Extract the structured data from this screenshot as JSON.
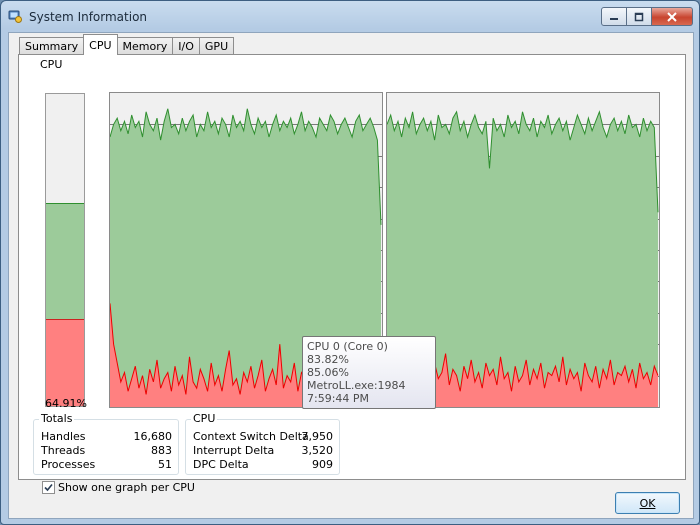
{
  "window": {
    "title": "System Information",
    "icon": "system-info-icon",
    "controls": [
      "minimize-icon",
      "maximize-icon",
      "close-icon"
    ]
  },
  "tabs": [
    {
      "label": "Summary",
      "active": false
    },
    {
      "label": "CPU",
      "active": true
    },
    {
      "label": "Memory",
      "active": false
    },
    {
      "label": "I/O",
      "active": false
    },
    {
      "label": "GPU",
      "active": false
    }
  ],
  "cpu_meter": {
    "label": "CPU",
    "percent_text": "64.91%",
    "total": 0.6491,
    "kernel": 0.2765
  },
  "colors": {
    "cpu_total_fill": "#9ccb9a",
    "cpu_total_line": "#2f8f2f",
    "cpu_kernel_fill": "#ff8080",
    "cpu_kernel_line": "#ee0000",
    "graph_background": "#f0f0f0",
    "gridline": "#7a7a7a"
  },
  "chart_data": [
    {
      "type": "area",
      "series": [
        {
          "values": [
            0.86,
            0.9,
            0.92,
            0.88,
            0.91,
            0.87,
            0.93,
            0.89,
            0.91,
            0.86,
            0.94,
            0.9,
            0.88,
            0.92,
            0.85,
            0.91,
            0.95,
            0.89,
            0.9,
            0.87,
            0.92,
            0.88,
            0.91,
            0.93,
            0.86,
            0.9,
            0.88,
            0.94,
            0.89,
            0.91,
            0.87,
            0.92,
            0.9,
            0.86,
            0.93,
            0.89,
            0.91,
            0.88,
            0.95,
            0.9,
            0.87,
            0.92,
            0.89,
            0.91,
            0.86,
            0.9,
            0.93,
            0.88,
            0.91,
            0.89,
            0.92,
            0.87,
            0.9,
            0.94,
            0.88,
            0.91,
            0.89,
            0.86,
            0.92,
            0.9,
            0.88,
            0.93,
            0.91,
            0.87,
            0.9,
            0.92,
            0.89,
            0.86,
            0.91,
            0.93,
            0.88,
            0.9,
            0.92,
            0.89,
            0.85,
            0.58
          ]
        },
        {
          "values": [
            0.33,
            0.2,
            0.14,
            0.08,
            0.11,
            0.05,
            0.09,
            0.13,
            0.06,
            0.1,
            0.04,
            0.12,
            0.08,
            0.15,
            0.06,
            0.09,
            0.11,
            0.05,
            0.13,
            0.07,
            0.1,
            0.04,
            0.16,
            0.08,
            0.06,
            0.12,
            0.09,
            0.05,
            0.14,
            0.07,
            0.1,
            0.05,
            0.12,
            0.18,
            0.07,
            0.09,
            0.04,
            0.11,
            0.08,
            0.13,
            0.06,
            0.1,
            0.15,
            0.05,
            0.09,
            0.12,
            0.07,
            0.2,
            0.06,
            0.1,
            0.08,
            0.14,
            0.05,
            0.11,
            0.09,
            0.06,
            0.13,
            0.08,
            0.17,
            0.07,
            0.1,
            0.05,
            0.12,
            0.09,
            0.06,
            0.15,
            0.08,
            0.11,
            0.05,
            0.13,
            0.07,
            0.1,
            0.16,
            0.08,
            0.09,
            0.06
          ]
        }
      ],
      "ylim": [
        0,
        1
      ],
      "grid": true
    },
    {
      "type": "area",
      "series": [
        {
          "values": [
            0.9,
            0.93,
            0.88,
            0.91,
            0.86,
            0.92,
            0.89,
            0.94,
            0.87,
            0.9,
            0.92,
            0.88,
            0.91,
            0.85,
            0.93,
            0.89,
            0.9,
            0.87,
            0.92,
            0.94,
            0.88,
            0.91,
            0.86,
            0.9,
            0.93,
            0.89,
            0.87,
            0.91,
            0.76,
            0.92,
            0.88,
            0.9,
            0.86,
            0.93,
            0.89,
            0.91,
            0.87,
            0.94,
            0.9,
            0.88,
            0.92,
            0.86,
            0.91,
            0.89,
            0.93,
            0.87,
            0.9,
            0.92,
            0.88,
            0.91,
            0.85,
            0.89,
            0.93,
            0.9,
            0.87,
            0.92,
            0.88,
            0.91,
            0.94,
            0.89,
            0.86,
            0.9,
            0.92,
            0.88,
            0.91,
            0.87,
            0.93,
            0.89,
            0.9,
            0.86,
            0.92,
            0.88,
            0.91,
            0.89,
            0.62
          ]
        },
        {
          "values": [
            0.18,
            0.12,
            0.16,
            0.09,
            0.14,
            0.11,
            0.07,
            0.13,
            0.1,
            0.15,
            0.08,
            0.12,
            0.06,
            0.14,
            0.09,
            0.11,
            0.17,
            0.07,
            0.12,
            0.1,
            0.05,
            0.13,
            0.09,
            0.15,
            0.08,
            0.11,
            0.06,
            0.14,
            0.1,
            0.12,
            0.07,
            0.16,
            0.09,
            0.11,
            0.05,
            0.13,
            0.08,
            0.1,
            0.15,
            0.07,
            0.12,
            0.09,
            0.14,
            0.06,
            0.11,
            0.1,
            0.13,
            0.08,
            0.16,
            0.07,
            0.12,
            0.09,
            0.11,
            0.05,
            0.14,
            0.1,
            0.08,
            0.13,
            0.06,
            0.12,
            0.09,
            0.15,
            0.07,
            0.11,
            0.1,
            0.13,
            0.08,
            0.12,
            0.06,
            0.14,
            0.09,
            0.11,
            0.07,
            0.13,
            0.1
          ]
        }
      ],
      "ylim": [
        0,
        1
      ],
      "grid": true
    }
  ],
  "tooltip": {
    "line1": "CPU 0 (Core 0) 83.82%",
    "line2": "85.06% MetroLL.exe:1984",
    "line3": "7:59:44 PM"
  },
  "totals": {
    "legend": "Totals",
    "rows": [
      {
        "label": "Handles",
        "value": "16,680"
      },
      {
        "label": "Threads",
        "value": "883"
      },
      {
        "label": "Processes",
        "value": "51"
      }
    ]
  },
  "cpu_stats": {
    "legend": "CPU",
    "rows": [
      {
        "label": "Context Switch Delta",
        "value": "7,950"
      },
      {
        "label": "Interrupt Delta",
        "value": "3,520"
      },
      {
        "label": "DPC Delta",
        "value": "909"
      }
    ]
  },
  "option": {
    "label": "Show one graph per CPU",
    "checked": true
  },
  "ok_label": "OK"
}
